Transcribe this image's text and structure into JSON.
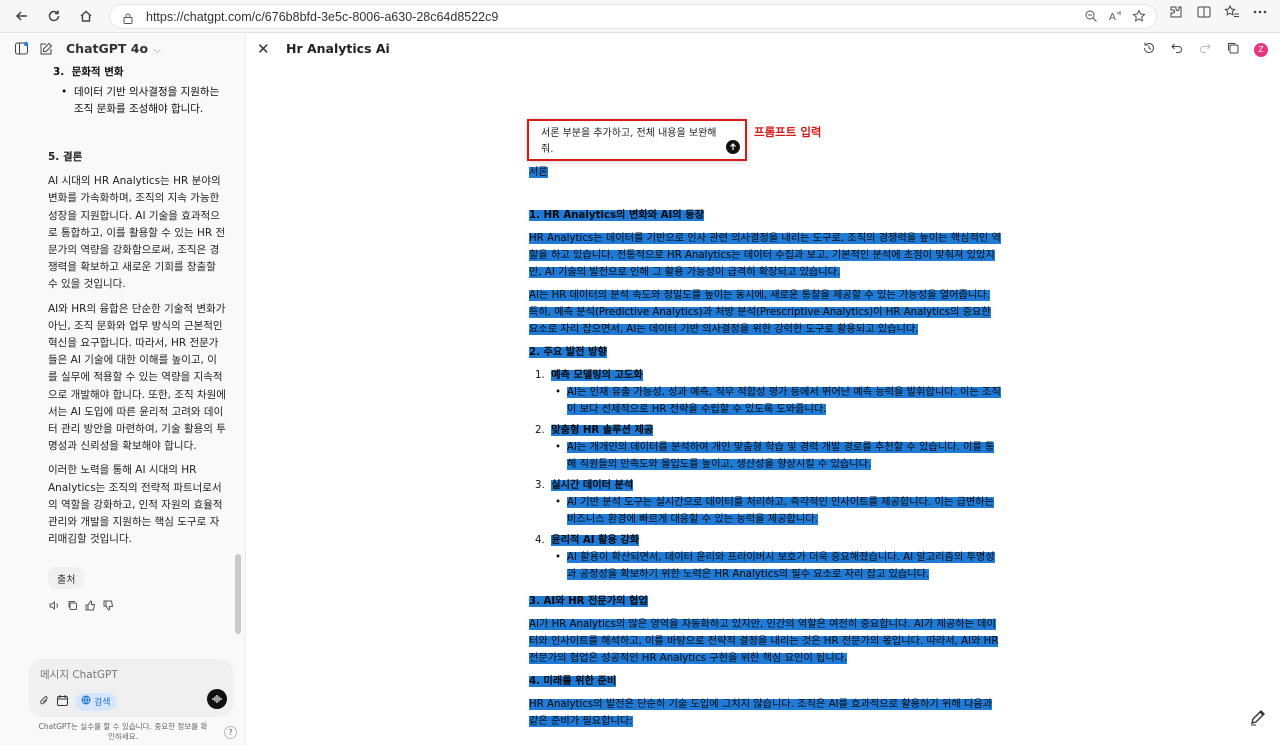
{
  "browser": {
    "url": "https://chatgpt.com/c/676b8bfd-3e5c-8006-a630-28c64d8522c9"
  },
  "sidebar": {
    "model_name": "ChatGPT 4o",
    "section3_number": "3.",
    "section3_title": "문화적 변화",
    "section3_bullet": "데이터 기반 의사결정을 지원하는 조직 문화를 조성해야 합니다.",
    "conclusion_title": "5. 결론",
    "para1": "AI 시대의 HR Analytics는 HR 분야의 변화를 가속화하며, 조직의 지속 가능한 성장을 지원합니다. AI 기술을 효과적으로 통합하고, 이를 활용할 수 있는 HR 전문가의 역량을 강화함으로써, 조직은 경쟁력을 확보하고 새로운 기회를 창출할 수 있을 것입니다.",
    "para2": "AI와 HR의 융합은 단순한 기술적 변화가 아닌, 조직 문화와 업무 방식의 근본적인 혁신을 요구합니다. 따라서, HR 전문가들은 AI 기술에 대한 이해를 높이고, 이를 실무에 적용할 수 있는 역량을 지속적으로 개발해야 합니다. 또한, 조직 차원에서는 AI 도입에 따른 윤리적 고려와 데이터 관리 방안을 마련하여, 기술 활용의 투명성과 신뢰성을 확보해야 합니다.",
    "para3": "이러한 노력을 통해 AI 시대의 HR Analytics는 조직의 전략적 파트너로서의 역할을 강화하고, 인적 자원의 효율적 관리와 개발을 지원하는 핵심 도구로 자리매김할 것입니다.",
    "source_label": "출처",
    "composer_placeholder": "메시지 ChatGPT",
    "search_label": "검색",
    "disclaimer": "ChatGPT는 실수를 할 수 있습니다. 중요한 정보를 확인하세요.",
    "help_label": "?"
  },
  "canvas": {
    "title": "Hr Analytics Ai",
    "avatar_letter": "Z",
    "prompt_text": "서론 부분을 추가하고, 전체 내용을 보완해줘.",
    "prompt_label": "프롬프트 입력"
  },
  "doc": {
    "intro": "서론",
    "s1_title": "1. HR Analytics의 변화와 AI의 등장",
    "s1_p1": "HR Analytics는 데이터를 기반으로 인사 관련 의사결정을 내리는 도구로, 조직의 경쟁력을 높이는 핵심적인 역할을 하고 있습니다. 전통적으로 HR Analytics는 데이터 수집과 보고, 기본적인 분석에 초점이 맞춰져 있었지만, AI 기술의 발전으로 인해 그 활용 가능성이 급격히 확장되고 있습니다.",
    "s1_p2": "AI는 HR 데이터의 분석 속도와 정밀도를 높이는 동시에, 새로운 통찰을 제공할 수 있는 가능성을 열어줍니다. 특히, 예측 분석(Predictive Analytics)과 처방 분석(Prescriptive Analytics)이 HR Analytics의 중요한 요소로 자리 잡으면서, AI는 데이터 기반 의사결정을 위한 강력한 도구로 활용되고 있습니다.",
    "s2_title": "2. 주요 발전 방향",
    "items": [
      {
        "num": "1.",
        "title": "예측 모델링의 고도화",
        "bullet": "AI는 인재 유출 가능성, 성과 예측, 직무 적합성 평가 등에서 뛰어난 예측 능력을 발휘합니다. 이는 조직이 보다 선제적으로 HR 전략을 수립할 수 있도록 도와줍니다."
      },
      {
        "num": "2.",
        "title": "맞춤형 HR 솔루션 제공",
        "bullet": "AI는 개개인의 데이터를 분석하여 개인 맞춤형 학습 및 경력 개발 경로를 추천할 수 있습니다. 이를 통해 직원들의 만족도와 몰입도를 높이고, 생산성을 향상시킬 수 있습니다."
      },
      {
        "num": "3.",
        "title": "실시간 데이터 분석",
        "bullet": "AI 기반 분석 도구는 실시간으로 데이터를 처리하고, 즉각적인 인사이트를 제공합니다. 이는 급변하는 비즈니스 환경에 빠르게 대응할 수 있는 능력을 제공합니다."
      },
      {
        "num": "4.",
        "title": "윤리적 AI 활용 강화",
        "bullet": "AI 활용이 확산되면서, 데이터 윤리와 프라이버시 보호가 더욱 중요해졌습니다. AI 알고리즘의 투명성과 공정성을 확보하기 위한 노력은 HR Analytics의 필수 요소로 자리 잡고 있습니다."
      }
    ],
    "s3_title": "3. AI와 HR 전문가의 협업",
    "s3_p1": "AI가 HR Analytics의 많은 영역을 자동화하고 있지만, 인간의 역할은 여전히 중요합니다. AI가 제공하는 데이터와 인사이트를 해석하고, 이를 바탕으로 전략적 결정을 내리는 것은 HR 전문가의 몫입니다. 따라서, AI와 HR 전문가의 협업은 성공적인 HR Analytics 구현을 위한 핵심 요인이 됩니다.",
    "s4_title": "4. 미래를 위한 준비",
    "s4_p1": "HR Analytics의 발전은 단순히 기술 도입에 그치지 않습니다. 조직은 AI를 효과적으로 활용하기 위해 다음과 같은 준비가 필요합니다:"
  }
}
